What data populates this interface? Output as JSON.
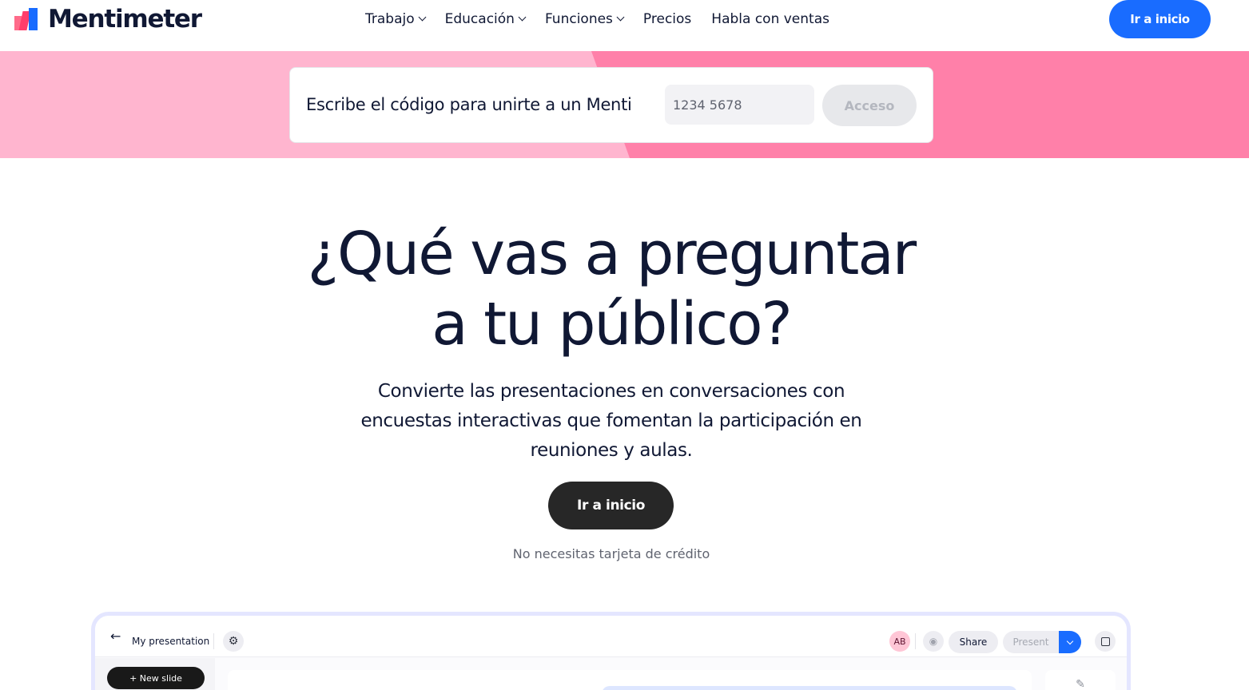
{
  "header": {
    "brand": "Mentimeter",
    "nav": [
      {
        "label": "Trabajo",
        "has_menu": true
      },
      {
        "label": "Educación",
        "has_menu": true
      },
      {
        "label": "Funciones",
        "has_menu": true
      },
      {
        "label": "Precios",
        "has_menu": false
      },
      {
        "label": "Habla con ventas",
        "has_menu": false
      }
    ],
    "cta_label": "Ir a inicio"
  },
  "join": {
    "label": "Escribe el código para unirte a un Menti",
    "placeholder": "1234 5678",
    "button_label": "Acceso"
  },
  "hero": {
    "title_line1": "¿Qué vas a preguntar",
    "title_line2": "a tu público?",
    "subtitle": "Convierte las presentaciones en conversaciones con encuestas interactivas que fomentan la participación en reuniones y aulas.",
    "cta_label": "Ir a inicio",
    "note": "No necesitas tarjeta de crédito"
  },
  "preview": {
    "back_icon": "←",
    "title": "My presentation",
    "settings_icon": "⚙",
    "avatar_initials": "AB",
    "eye_icon": "◉",
    "share_label": "Share",
    "present_label": "Present",
    "new_slide_label": "+ New slide",
    "edit_icon": "✎"
  },
  "colors": {
    "accent": "#196cff",
    "band_light": "#ffb5cf",
    "band_pink": "#ff80a9",
    "dark_button": "#272727"
  }
}
